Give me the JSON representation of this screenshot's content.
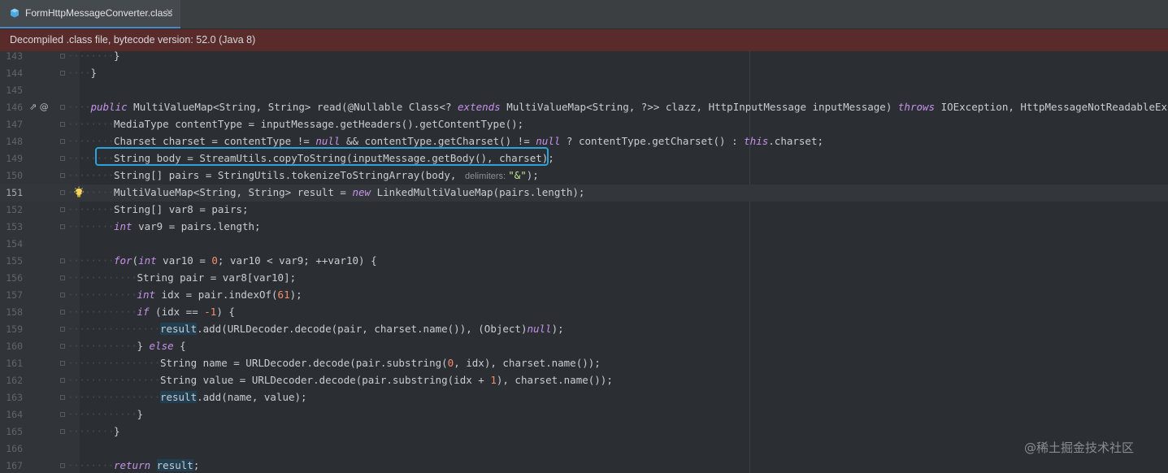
{
  "tab": {
    "label": "FormHttpMessageConverter.class",
    "close": "×"
  },
  "banner": {
    "text": "Decompiled .class file, bytecode version: 52.0 (Java 8)"
  },
  "watermark": "@稀土掘金技术社区",
  "editor": {
    "active_line": "151",
    "lines": [
      {
        "n": "143",
        "indent": 2,
        "segments": [
          {
            "t": "}",
            "c": "p"
          }
        ]
      },
      {
        "n": "144",
        "indent": 1,
        "segments": [
          {
            "t": "}",
            "c": "p"
          }
        ]
      },
      {
        "n": "145",
        "indent": 0,
        "segments": []
      },
      {
        "n": "146",
        "indent": 1,
        "icons": "⇗ @",
        "segments": [
          {
            "t": "public",
            "c": "kw"
          },
          {
            "t": " MultiValueMap<String, String> read(@Nullable Class<? ",
            "c": "p"
          },
          {
            "t": "extends",
            "c": "kw"
          },
          {
            "t": " MultiValueMap<String, ?>> clazz, HttpInputMessage inputMessage) ",
            "c": "p"
          },
          {
            "t": "throws",
            "c": "kw"
          },
          {
            "t": " IOException, HttpMessageNotReadableException {",
            "c": "p"
          }
        ]
      },
      {
        "n": "147",
        "indent": 2,
        "segments": [
          {
            "t": "MediaType contentType = inputMessage.getHeaders().getContentType();",
            "c": "p"
          }
        ]
      },
      {
        "n": "148",
        "indent": 2,
        "segments": [
          {
            "t": "Charset charset = contentType != ",
            "c": "p"
          },
          {
            "t": "null",
            "c": "kw"
          },
          {
            "t": " && contentType.getCharset() != ",
            "c": "p"
          },
          {
            "t": "null",
            "c": "kw"
          },
          {
            "t": " ? contentType.getCharset() : ",
            "c": "p"
          },
          {
            "t": "this",
            "c": "kw"
          },
          {
            "t": ".charset;",
            "c": "p"
          }
        ]
      },
      {
        "n": "149",
        "indent": 2,
        "segments": [
          {
            "t": "String body = StreamUtils.copyToString(inputMessage.getBody(), charset);",
            "c": "p"
          }
        ]
      },
      {
        "n": "150",
        "indent": 2,
        "segments": [
          {
            "t": "String[] pairs = StringUtils.tokenizeToStringArray(body, ",
            "c": "p"
          },
          {
            "t": " delimiters: ",
            "c": "hint"
          },
          {
            "t": "\"&\"",
            "c": "str"
          },
          {
            "t": ");",
            "c": "p"
          }
        ]
      },
      {
        "n": "151",
        "indent": 2,
        "bulb": true,
        "segments": [
          {
            "t": "MultiValueMap<String, String> result = ",
            "c": "p"
          },
          {
            "t": "new",
            "c": "kw"
          },
          {
            "t": " LinkedMultiValueMap(pairs.length);",
            "c": "p"
          }
        ]
      },
      {
        "n": "152",
        "indent": 2,
        "segments": [
          {
            "t": "String[] var8 = pairs;",
            "c": "p"
          }
        ]
      },
      {
        "n": "153",
        "indent": 2,
        "segments": [
          {
            "t": "int",
            "c": "kw"
          },
          {
            "t": " var9 = pairs.length;",
            "c": "p"
          }
        ]
      },
      {
        "n": "154",
        "indent": 0,
        "segments": []
      },
      {
        "n": "155",
        "indent": 2,
        "segments": [
          {
            "t": "for",
            "c": "kw"
          },
          {
            "t": "(",
            "c": "p"
          },
          {
            "t": "int",
            "c": "kw"
          },
          {
            "t": " var10 = ",
            "c": "p"
          },
          {
            "t": "0",
            "c": "num"
          },
          {
            "t": "; var10 < var9; ++var10) {",
            "c": "p"
          }
        ]
      },
      {
        "n": "156",
        "indent": 3,
        "segments": [
          {
            "t": "String pair = var8[var10];",
            "c": "p"
          }
        ]
      },
      {
        "n": "157",
        "indent": 3,
        "segments": [
          {
            "t": "int",
            "c": "kw"
          },
          {
            "t": " idx = pair.indexOf(",
            "c": "p"
          },
          {
            "t": "61",
            "c": "num"
          },
          {
            "t": ");",
            "c": "p"
          }
        ]
      },
      {
        "n": "158",
        "indent": 3,
        "segments": [
          {
            "t": "if",
            "c": "kw"
          },
          {
            "t": " (idx == ",
            "c": "p"
          },
          {
            "t": "-1",
            "c": "num"
          },
          {
            "t": ") {",
            "c": "p"
          }
        ]
      },
      {
        "n": "159",
        "indent": 4,
        "segments": [
          {
            "t": "result",
            "c": "hl"
          },
          {
            "t": ".add(URLDecoder.decode(pair, charset.name()), (Object)",
            "c": "p"
          },
          {
            "t": "null",
            "c": "kw"
          },
          {
            "t": ");",
            "c": "p"
          }
        ]
      },
      {
        "n": "160",
        "indent": 3,
        "segments": [
          {
            "t": "} ",
            "c": "p"
          },
          {
            "t": "else",
            "c": "kw"
          },
          {
            "t": " {",
            "c": "p"
          }
        ]
      },
      {
        "n": "161",
        "indent": 4,
        "segments": [
          {
            "t": "String name = URLDecoder.decode(pair.substring(",
            "c": "p"
          },
          {
            "t": "0",
            "c": "num"
          },
          {
            "t": ", idx), charset.name());",
            "c": "p"
          }
        ]
      },
      {
        "n": "162",
        "indent": 4,
        "segments": [
          {
            "t": "String value = URLDecoder.decode(pair.substring(idx + ",
            "c": "p"
          },
          {
            "t": "1",
            "c": "num"
          },
          {
            "t": "), charset.name());",
            "c": "p"
          }
        ]
      },
      {
        "n": "163",
        "indent": 4,
        "segments": [
          {
            "t": "result",
            "c": "hl"
          },
          {
            "t": ".add(name, value);",
            "c": "p"
          }
        ]
      },
      {
        "n": "164",
        "indent": 3,
        "segments": [
          {
            "t": "}",
            "c": "p"
          }
        ]
      },
      {
        "n": "165",
        "indent": 2,
        "segments": [
          {
            "t": "}",
            "c": "p"
          }
        ]
      },
      {
        "n": "166",
        "indent": 0,
        "segments": []
      },
      {
        "n": "167",
        "indent": 2,
        "segments": [
          {
            "t": "return",
            "c": "kw"
          },
          {
            "t": " ",
            "c": "p"
          },
          {
            "t": "result",
            "c": "hl"
          },
          {
            "t": ";",
            "c": "p"
          }
        ]
      }
    ]
  }
}
